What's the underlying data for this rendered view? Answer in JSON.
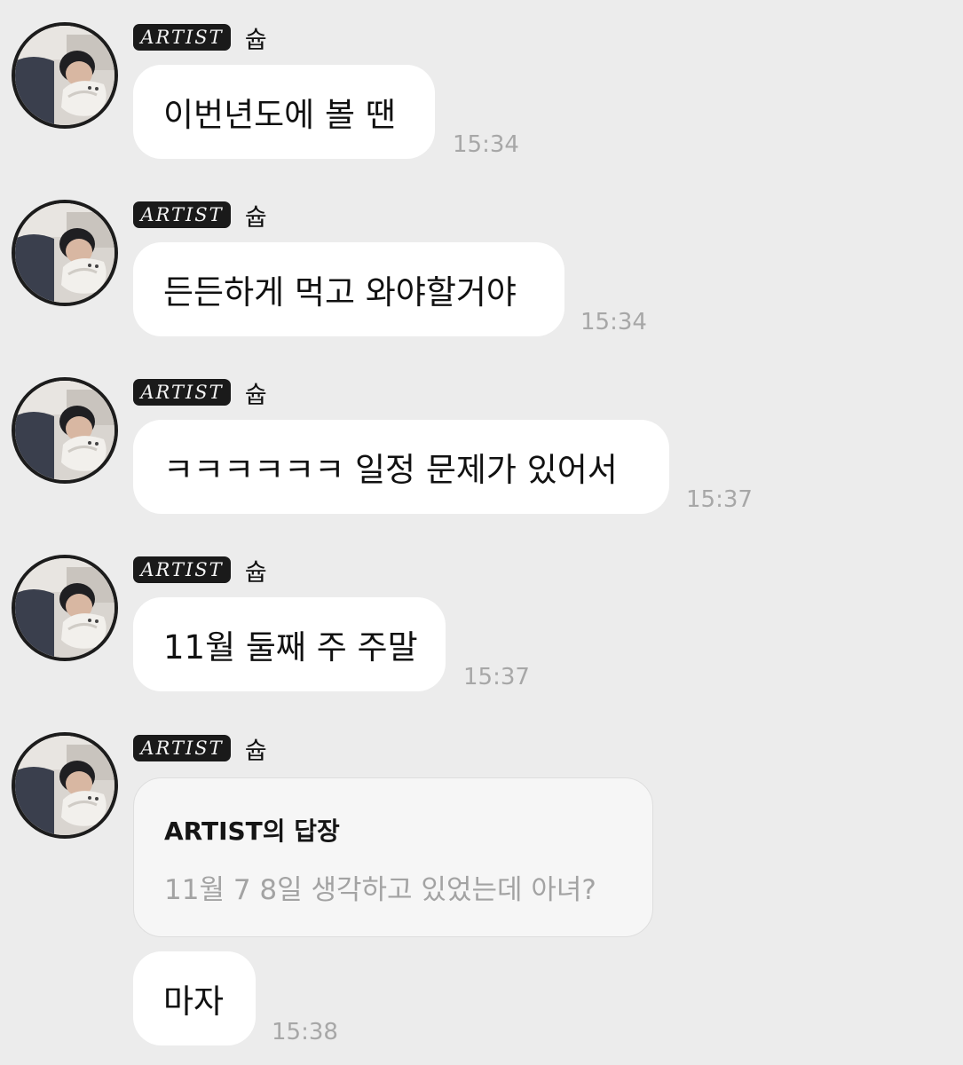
{
  "messages": [
    {
      "badge": "ARTIST",
      "sender": "슙",
      "avatar": "profile-photo-person-with-cat",
      "text": "이번년도에 볼 땐",
      "time": "15:34"
    },
    {
      "badge": "ARTIST",
      "sender": "슙",
      "avatar": "profile-photo-person-with-cat",
      "text": "든든하게 먹고 와야할거야",
      "time": "15:34"
    },
    {
      "badge": "ARTIST",
      "sender": "슙",
      "avatar": "profile-photo-person-with-cat",
      "text": "ㅋㅋㅋㅋㅋㅋ 일정 문제가 있어서",
      "time": "15:37"
    },
    {
      "badge": "ARTIST",
      "sender": "슙",
      "avatar": "profile-photo-person-with-cat",
      "text": "11월 둘째 주 주말",
      "time": "15:37"
    },
    {
      "badge": "ARTIST",
      "sender": "슙",
      "avatar": "profile-photo-person-with-cat",
      "reply": {
        "title": "ARTIST의 답장",
        "quote": "11월 7 8일 생각하고 있었는데 아녀?"
      },
      "text": "마자",
      "time": "15:38"
    }
  ],
  "colors": {
    "background": "#ececec",
    "bubble": "#ffffff",
    "badge": "#1a1a1a",
    "timestamp": "#a7a7a7"
  }
}
